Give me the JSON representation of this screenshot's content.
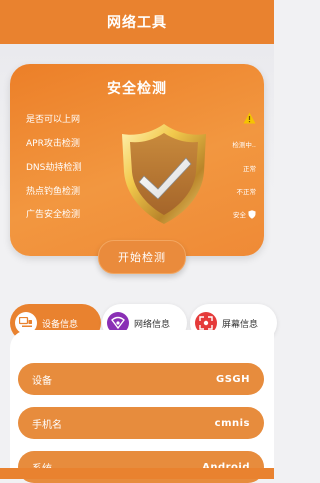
{
  "header": {
    "title": "网络工具"
  },
  "security": {
    "title": "安全检测",
    "rows": [
      {
        "label": "是否可以上网",
        "status": "",
        "status_icon": "warning-icon"
      },
      {
        "label": "APR攻击检测",
        "status": "检测中.."
      },
      {
        "label": "DNS劫持检测",
        "status": "正常"
      },
      {
        "label": "热点钓鱼检测",
        "status": "不正常"
      },
      {
        "label": "广告安全检测",
        "status": "安全",
        "status_icon": "shield-small-icon"
      }
    ],
    "start_label": "开始检测"
  },
  "tabs": [
    {
      "label": "设备信息",
      "icon": "device-info-icon",
      "active": true
    },
    {
      "label": "网络信息",
      "icon": "network-info-icon",
      "active": false
    },
    {
      "label": "屏幕信息",
      "icon": "screen-info-icon",
      "active": false
    }
  ],
  "info": [
    {
      "label": "设备",
      "value": "GSGH"
    },
    {
      "label": "手机名",
      "value": "cmnis"
    },
    {
      "label": "系统",
      "value": "Android"
    }
  ],
  "colors": {
    "primary": "#e9822f",
    "card_light": "#f29740",
    "background": "#f1f1f3"
  }
}
